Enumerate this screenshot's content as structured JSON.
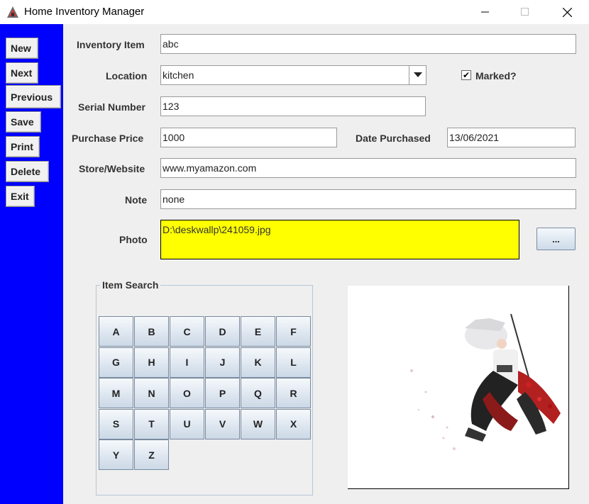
{
  "window": {
    "title": "Home Inventory Manager"
  },
  "toolbar": {
    "buttons": [
      "New",
      "Next",
      "Previous",
      "Save",
      "Print",
      "Delete",
      "Exit"
    ]
  },
  "form": {
    "inventory_item": {
      "label": "Inventory Item",
      "value": "abc"
    },
    "location": {
      "label": "Location",
      "value": "kitchen"
    },
    "marked": {
      "label": "Marked?",
      "checked": true,
      "mark": "✔"
    },
    "serial_number": {
      "label": "Serial Number",
      "value": "123"
    },
    "purchase_price": {
      "label": "Purchase Price",
      "value": "1000"
    },
    "date_purchased": {
      "label": "Date Purchased",
      "value": "13/06/2021"
    },
    "store_website": {
      "label": "Store/Website",
      "value": "www.myamazon.com"
    },
    "note": {
      "label": "Note",
      "value": "none"
    },
    "photo": {
      "label": "Photo",
      "value": "D:\\deskwallp\\241059.jpg",
      "browse_label": "..."
    }
  },
  "item_search": {
    "title": "Item Search",
    "letters": [
      "A",
      "B",
      "C",
      "D",
      "E",
      "F",
      "G",
      "H",
      "I",
      "J",
      "K",
      "L",
      "M",
      "N",
      "O",
      "P",
      "Q",
      "R",
      "S",
      "T",
      "U",
      "V",
      "W",
      "X",
      "Y",
      "Z"
    ]
  },
  "colors": {
    "sidebar": "#0000ff",
    "photo_field": "#ffff00"
  }
}
